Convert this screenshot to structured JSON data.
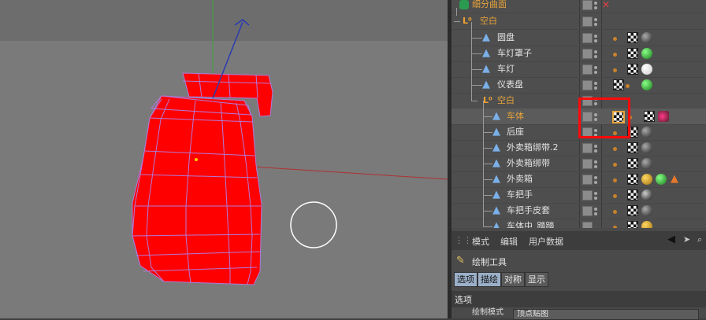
{
  "objects": [
    {
      "label": "细分曲面",
      "color": "orange"
    },
    {
      "label": "空白",
      "color": "orange"
    },
    {
      "label": "圆盘",
      "color": "normal"
    },
    {
      "label": "车灯罩子",
      "color": "normal"
    },
    {
      "label": "车灯",
      "color": "normal"
    },
    {
      "label": "仪表盘",
      "color": "normal"
    },
    {
      "label": "空白",
      "color": "orange"
    },
    {
      "label": "车体",
      "color": "orange"
    },
    {
      "label": "后座",
      "color": "normal"
    },
    {
      "label": "外卖箱绑带.2",
      "color": "normal"
    },
    {
      "label": "外卖箱绑带",
      "color": "normal"
    },
    {
      "label": "外卖箱",
      "color": "normal"
    },
    {
      "label": "车把手",
      "color": "normal"
    },
    {
      "label": "车把手皮套",
      "color": "normal"
    },
    {
      "label": "车体中_踏踏",
      "color": "normal"
    }
  ],
  "attributes": {
    "menu": {
      "mode": "模式",
      "edit": "编辑",
      "user_data": "用户数据"
    },
    "tool_title": "绘制工具",
    "tabs": [
      "选项",
      "描绘",
      "对称",
      "显示"
    ],
    "section_title": "选项",
    "field_label": "绘制模式",
    "field_value": "顶点贴图"
  },
  "colors": {
    "model_fill": "#ff0000",
    "wire": "#b07ad8",
    "highlight_box": "#ff0a0a",
    "selected_label": "#e6a33a",
    "tab_active": "#9bb0c8"
  },
  "icons": {
    "layer": "layer-icon",
    "polygon": "polygon-object-icon",
    "null": "null-object-icon",
    "subdivision": "subdivision-surface-icon",
    "material": "material-ball-icon",
    "texture": "checker-texture-tag-icon",
    "phong": "phong-tag-icon",
    "brush": "brush-cursor-icon"
  }
}
